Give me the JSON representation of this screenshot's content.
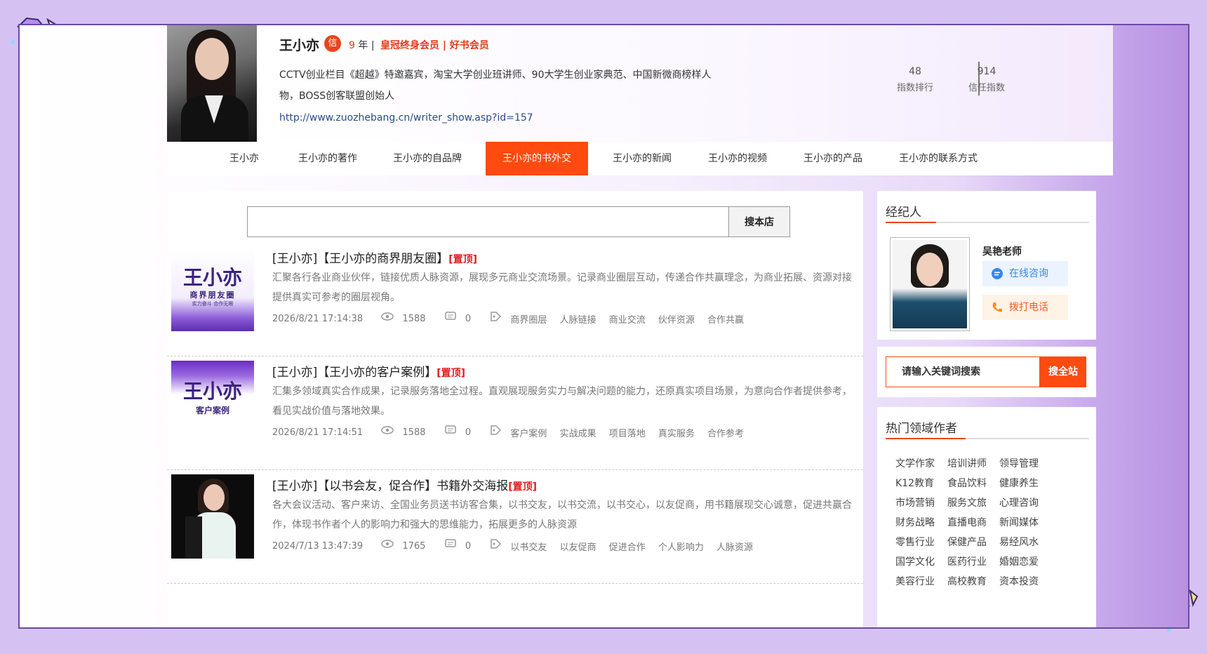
{
  "header": {
    "author_name": "王小亦",
    "verified_badge": "信",
    "years_num": "9",
    "years_unit": " 年 |",
    "membership": "皇冠终身会员 | 好书会员",
    "bio": "CCTV创业栏目《超越》特邀嘉宾，淘宝大学创业班讲师、90大学生创业家典范、中国新微商榜样人物，BOSS创客联盟创始人",
    "link": "http://www.zuozhebang.cn/writer_show.asp?id=157",
    "stats": [
      {
        "value": "48",
        "label": "指数排行"
      },
      {
        "value": "914",
        "label": "信任指数"
      }
    ]
  },
  "nav": {
    "items": [
      "王小亦",
      "王小亦的著作",
      "王小亦的自品牌",
      "王小亦的书外交",
      "王小亦的新闻",
      "王小亦的视频",
      "王小亦的产品",
      "王小亦的联系方式"
    ],
    "active_index": 3
  },
  "shop_search": {
    "button": "搜本店"
  },
  "articles": [
    {
      "prefix": "[王小亦]【王小亦的商界朋友圈】",
      "top": "[置顶]",
      "desc": "汇聚各行各业商业伙伴，链接优质人脉资源，展现多元商业交流场景。记录商业圈层互动，传递合作共赢理念，为商业拓展、资源对接提供真实可参考的圈层视角。",
      "date": "2026/8/21 17:14:38",
      "views": "1588",
      "comments": "0",
      "tags": [
        "商界圈层",
        "人脉链接",
        "商业交流",
        "伙伴资源",
        "合作共赢"
      ],
      "thumb": {
        "title": "王小亦",
        "sub": "商界朋友圈",
        "slogan": "实力奋斗 合作无限"
      }
    },
    {
      "prefix": "[王小亦]【王小亦的客户案例】",
      "top": "[置顶]",
      "desc": "汇集多领域真实合作成果，记录服务落地全过程。直观展现服务实力与解决问题的能力，还原真实项目场景，为意向合作者提供参考，看见实战价值与落地效果。",
      "date": "2026/8/21 17:14:51",
      "views": "1588",
      "comments": "0",
      "tags": [
        "客户案例",
        "实战成果",
        "项目落地",
        "真实服务",
        "合作参考"
      ],
      "thumb": {
        "title": "王小亦",
        "sub": "客户案例"
      }
    },
    {
      "prefix": "[王小亦]【以书会友，促合作】书籍外交海报",
      "top": "[置顶]",
      "desc": "各大会议活动、客户来访、全国业务员送书访客合集，以书交友，以书交流，以书交心，以友促商，用书籍展现交心诚意，促进共赢合作，体现书作者个人的影响力和强大的思维能力，拓展更多的人脉资源",
      "date": "2024/7/13 13:47:39",
      "views": "1765",
      "comments": "0",
      "tags": [
        "以书交友",
        "以友促商",
        "促进合作",
        "个人影响力",
        "人脉资源"
      ]
    }
  ],
  "sidebar": {
    "agent_title": "经纪人",
    "agent_name": "吴艳老师",
    "consult": "在线咨询",
    "call": "拨打电话",
    "search_placeholder": "请输入关键词搜索",
    "search_button": "搜全站",
    "hot_title": "热门领域作者",
    "hot": [
      [
        "文学作家",
        "培训讲师",
        "领导管理"
      ],
      [
        "K12教育",
        "食品饮料",
        "健康养生"
      ],
      [
        "市场营销",
        "服务文旅",
        "心理咨询"
      ],
      [
        "财务战略",
        "直播电商",
        "新闻媒体"
      ],
      [
        "零售行业",
        "保健产品",
        "易经风水"
      ],
      [
        "国学文化",
        "医药行业",
        "婚姻恋爱"
      ],
      [
        "美容行业",
        "高校教育",
        "资本投资"
      ]
    ]
  },
  "colors": {
    "accent": "#ff4b0f",
    "frame": "#6b4aa8",
    "top_tag": "#e31c1c",
    "link": "#2a4b8d"
  },
  "icons": [
    "eye-icon",
    "comment-icon",
    "tag-icon",
    "chat-icon",
    "phone-icon",
    "crystal-gem-icon"
  ]
}
